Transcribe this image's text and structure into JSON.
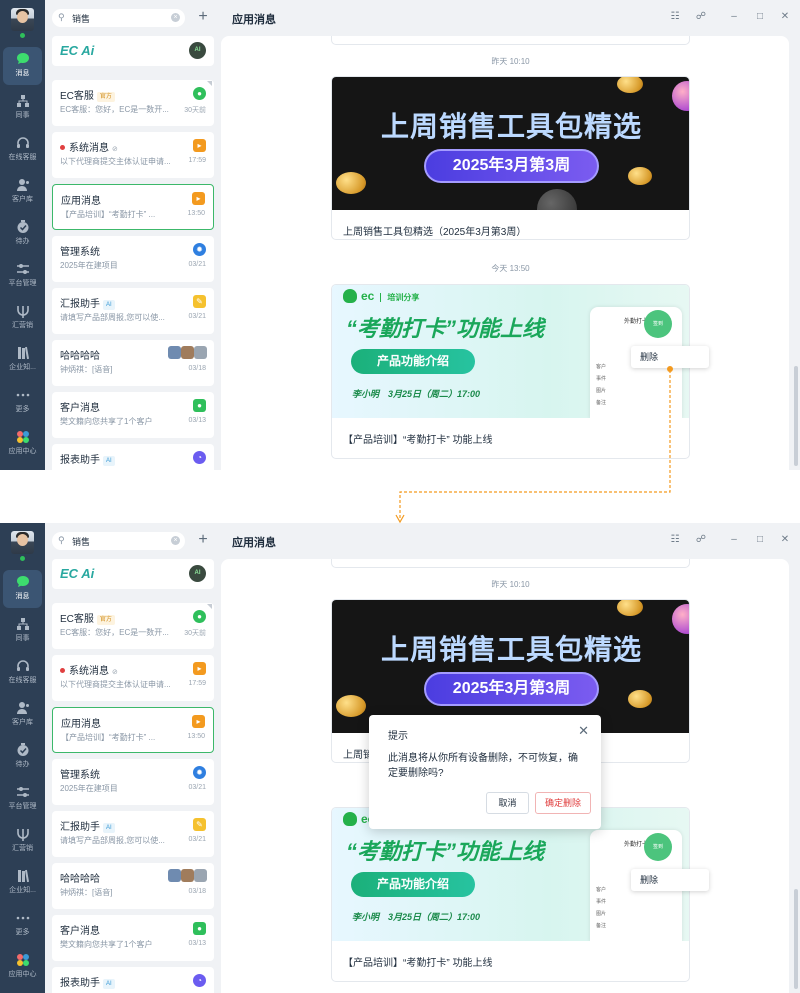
{
  "sidebar": {
    "items": [
      {
        "label": "消息",
        "icon": "chat-icon"
      },
      {
        "label": "同事",
        "icon": "org-icon"
      },
      {
        "label": "在线客服",
        "icon": "headset-icon"
      },
      {
        "label": "客户库",
        "icon": "customers-icon"
      },
      {
        "label": "待办",
        "icon": "todo-icon"
      },
      {
        "label": "平台管理",
        "icon": "sliders-icon"
      },
      {
        "label": "汇营销",
        "icon": "trident-icon"
      },
      {
        "label": "企业知...",
        "icon": "books-icon"
      },
      {
        "label": "更多",
        "icon": "more-icon"
      },
      {
        "label": "应用中心",
        "icon": "apps-icon"
      }
    ]
  },
  "search": {
    "value": "销售"
  },
  "ec_ai": {
    "logo": "EC Ai"
  },
  "conversations": [
    {
      "name": "EC客服",
      "tag": "官方",
      "preview": "EC客服：您好，EC是一数开...",
      "time": "30天前",
      "icon_color": "#2fbf5b"
    },
    {
      "name": "系统消息",
      "unread": true,
      "muted": true,
      "preview": "以下代理商提交主体认证申请...",
      "time": "17:59",
      "icon_color": "#f39a1f"
    },
    {
      "name": "应用消息",
      "selected": true,
      "preview": "【产品培训】“考勤打卡” ...",
      "time": "13:50",
      "icon_color": "#f39a1f"
    },
    {
      "name": "管理系统",
      "preview": "2025年在建项目",
      "time": "03/21",
      "icon_color": "#2f7fe0"
    },
    {
      "name": "汇报助手",
      "tag": "AI",
      "preview": "请填写产品部周报,您可以使...",
      "time": "03/21",
      "icon_color": "#f5c12e"
    },
    {
      "name": "哈哈哈哈",
      "preview": "钟炳祺：[语音]",
      "time": "03/18",
      "icon_color": "#7f8a99"
    },
    {
      "name": "客户消息",
      "preview": "樊文籍向您共享了1个客户",
      "time": "03/13",
      "icon_color": "#2fbf5b"
    },
    {
      "name": "报表助手",
      "tag": "AI",
      "preview": "",
      "time": "",
      "icon_color": "#6b5cf0"
    }
  ],
  "header": {
    "title": "应用消息"
  },
  "window_controls": {
    "gift": "gift-icon",
    "headset": "headset-icon",
    "minimize": "–",
    "maximize": "□",
    "close": "✕"
  },
  "chat": {
    "stamp_yesterday": "昨天 10:10",
    "card1": {
      "headline": "上周销售工具包精选",
      "pill": "2025年3月第3周",
      "caption": "上周销售工具包精选（2025年3月第3周）"
    },
    "stamp_today": "今天 13:50",
    "card2": {
      "brand": "ec",
      "brand_sub": "培训分享",
      "headline": "“考勤打卡”功能上线",
      "pill": "产品功能介绍",
      "who": "李小明　3月25日（周二）17:00",
      "phone_title": "外勤打卡",
      "phone_badge": "签到",
      "phone_rows": [
        "客户",
        "事件",
        "图片",
        "备注"
      ],
      "caption": "【产品培训】“考勤打卡” 功能上线"
    },
    "context_menu": {
      "delete": "删除"
    }
  },
  "dialog": {
    "title": "提示",
    "message": "此消息将从你所有设备删除，不可恢复，确定要删除吗?",
    "cancel": "取消",
    "confirm": "确定删除"
  },
  "colors": {
    "accent": "#2fbf5b",
    "rail": "#2d3f55",
    "connector": "#f39a1f",
    "danger": "#e03c3c"
  }
}
